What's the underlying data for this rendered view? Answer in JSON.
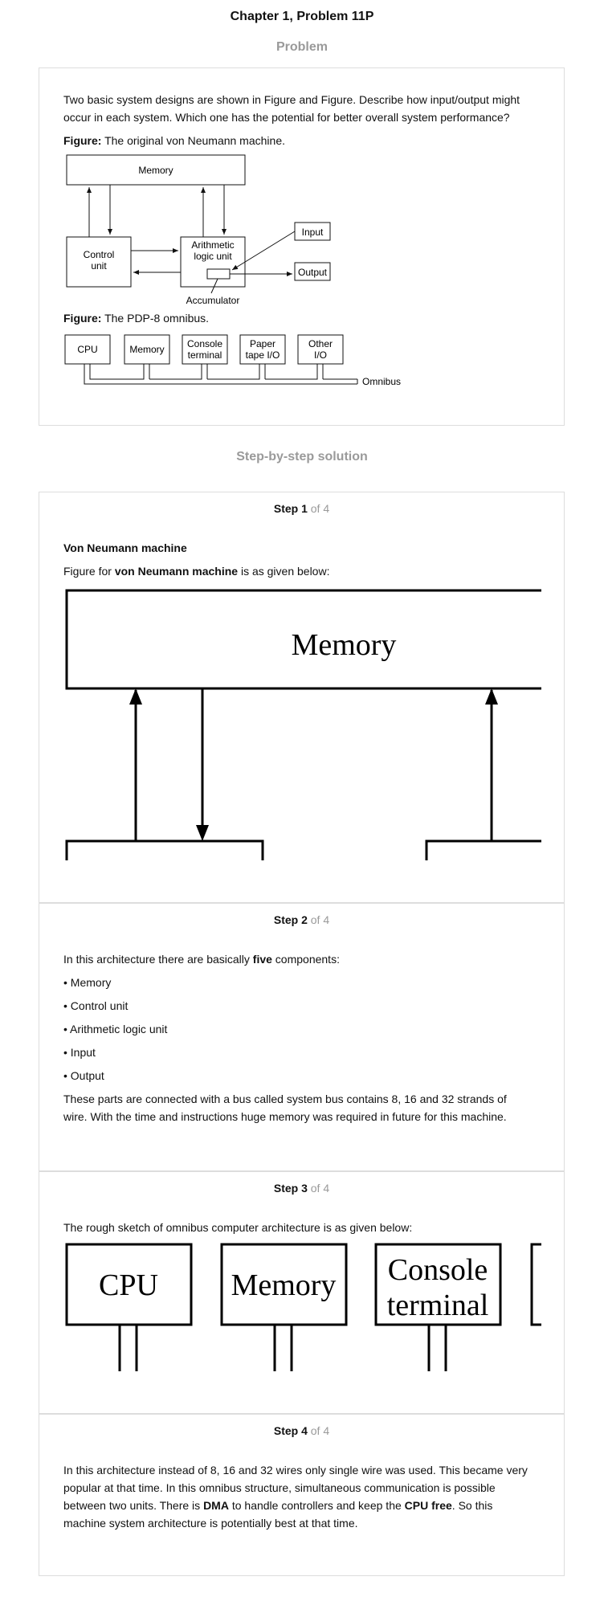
{
  "header": {
    "title": "Chapter 1, Problem 11P"
  },
  "problem": {
    "heading": "Problem",
    "question_line1": "Two basic system designs are shown in Figure and Figure. Describe how input/output might",
    "question_line2": "occur in each system. Which one has the potential for better overall system performance?",
    "figure1_label": "Figure:",
    "figure1_caption": " The original von Neumann machine.",
    "figure2_label": "Figure:",
    "figure2_caption": " The PDP-8 omnibus.",
    "vn_diagram": {
      "memory": "Memory",
      "control_1": "Control",
      "control_2": "unit",
      "alu_1": "Arithmetic",
      "alu_2": "logic unit",
      "input": "Input",
      "output": "Output",
      "accumulator": "Accumulator"
    },
    "pdp_diagram": {
      "cpu": "CPU",
      "memory": "Memory",
      "console_1": "Console",
      "console_2": "terminal",
      "paper_1": "Paper",
      "paper_2": "tape I/O",
      "other_1": "Other",
      "other_2": "I/O",
      "omnibus": "Omnibus"
    }
  },
  "solution": {
    "heading": "Step-by-step solution",
    "steps": [
      {
        "label": "Step 1",
        "of": " of 4",
        "title": "Von Neumann machine",
        "text_pre": "Figure for ",
        "text_bold": "von Neumann machine",
        "text_post": " is as given below:",
        "diagram_memory": "Memory"
      },
      {
        "label": "Step 2",
        "of": " of 4",
        "intro_pre": "In this architecture there are basically ",
        "intro_bold": "five",
        "intro_post": " components:",
        "bullets": [
          "• Memory",
          "• Control unit",
          "• Arithmetic logic unit",
          "• Input",
          "• Output"
        ],
        "para_line1": "These parts are connected with a bus called system bus contains 8, 16 and 32 strands of",
        "para_line2": "wire. With the time and instructions huge memory was required in future for this machine."
      },
      {
        "label": "Step 3",
        "of": " of 4",
        "text": "The rough sketch of omnibus computer architecture is as given below:",
        "box_cpu": "CPU",
        "box_memory": "Memory",
        "box_console_1": "Console",
        "box_console_2": "terminal"
      },
      {
        "label": "Step 4",
        "of": " of 4",
        "line1": "In this architecture instead of 8, 16 and 32 wires only single wire was used. This became very",
        "line2": "popular at that time. In this omnibus structure, simultaneous communication is possible",
        "line3_pre": "between two units. There is ",
        "line3_bold1": "DMA",
        "line3_mid": " to handle controllers and keep the ",
        "line3_bold2": "CPU free",
        "line3_post": ". So this",
        "line4": "machine system architecture is potentially best at that time."
      }
    ]
  }
}
